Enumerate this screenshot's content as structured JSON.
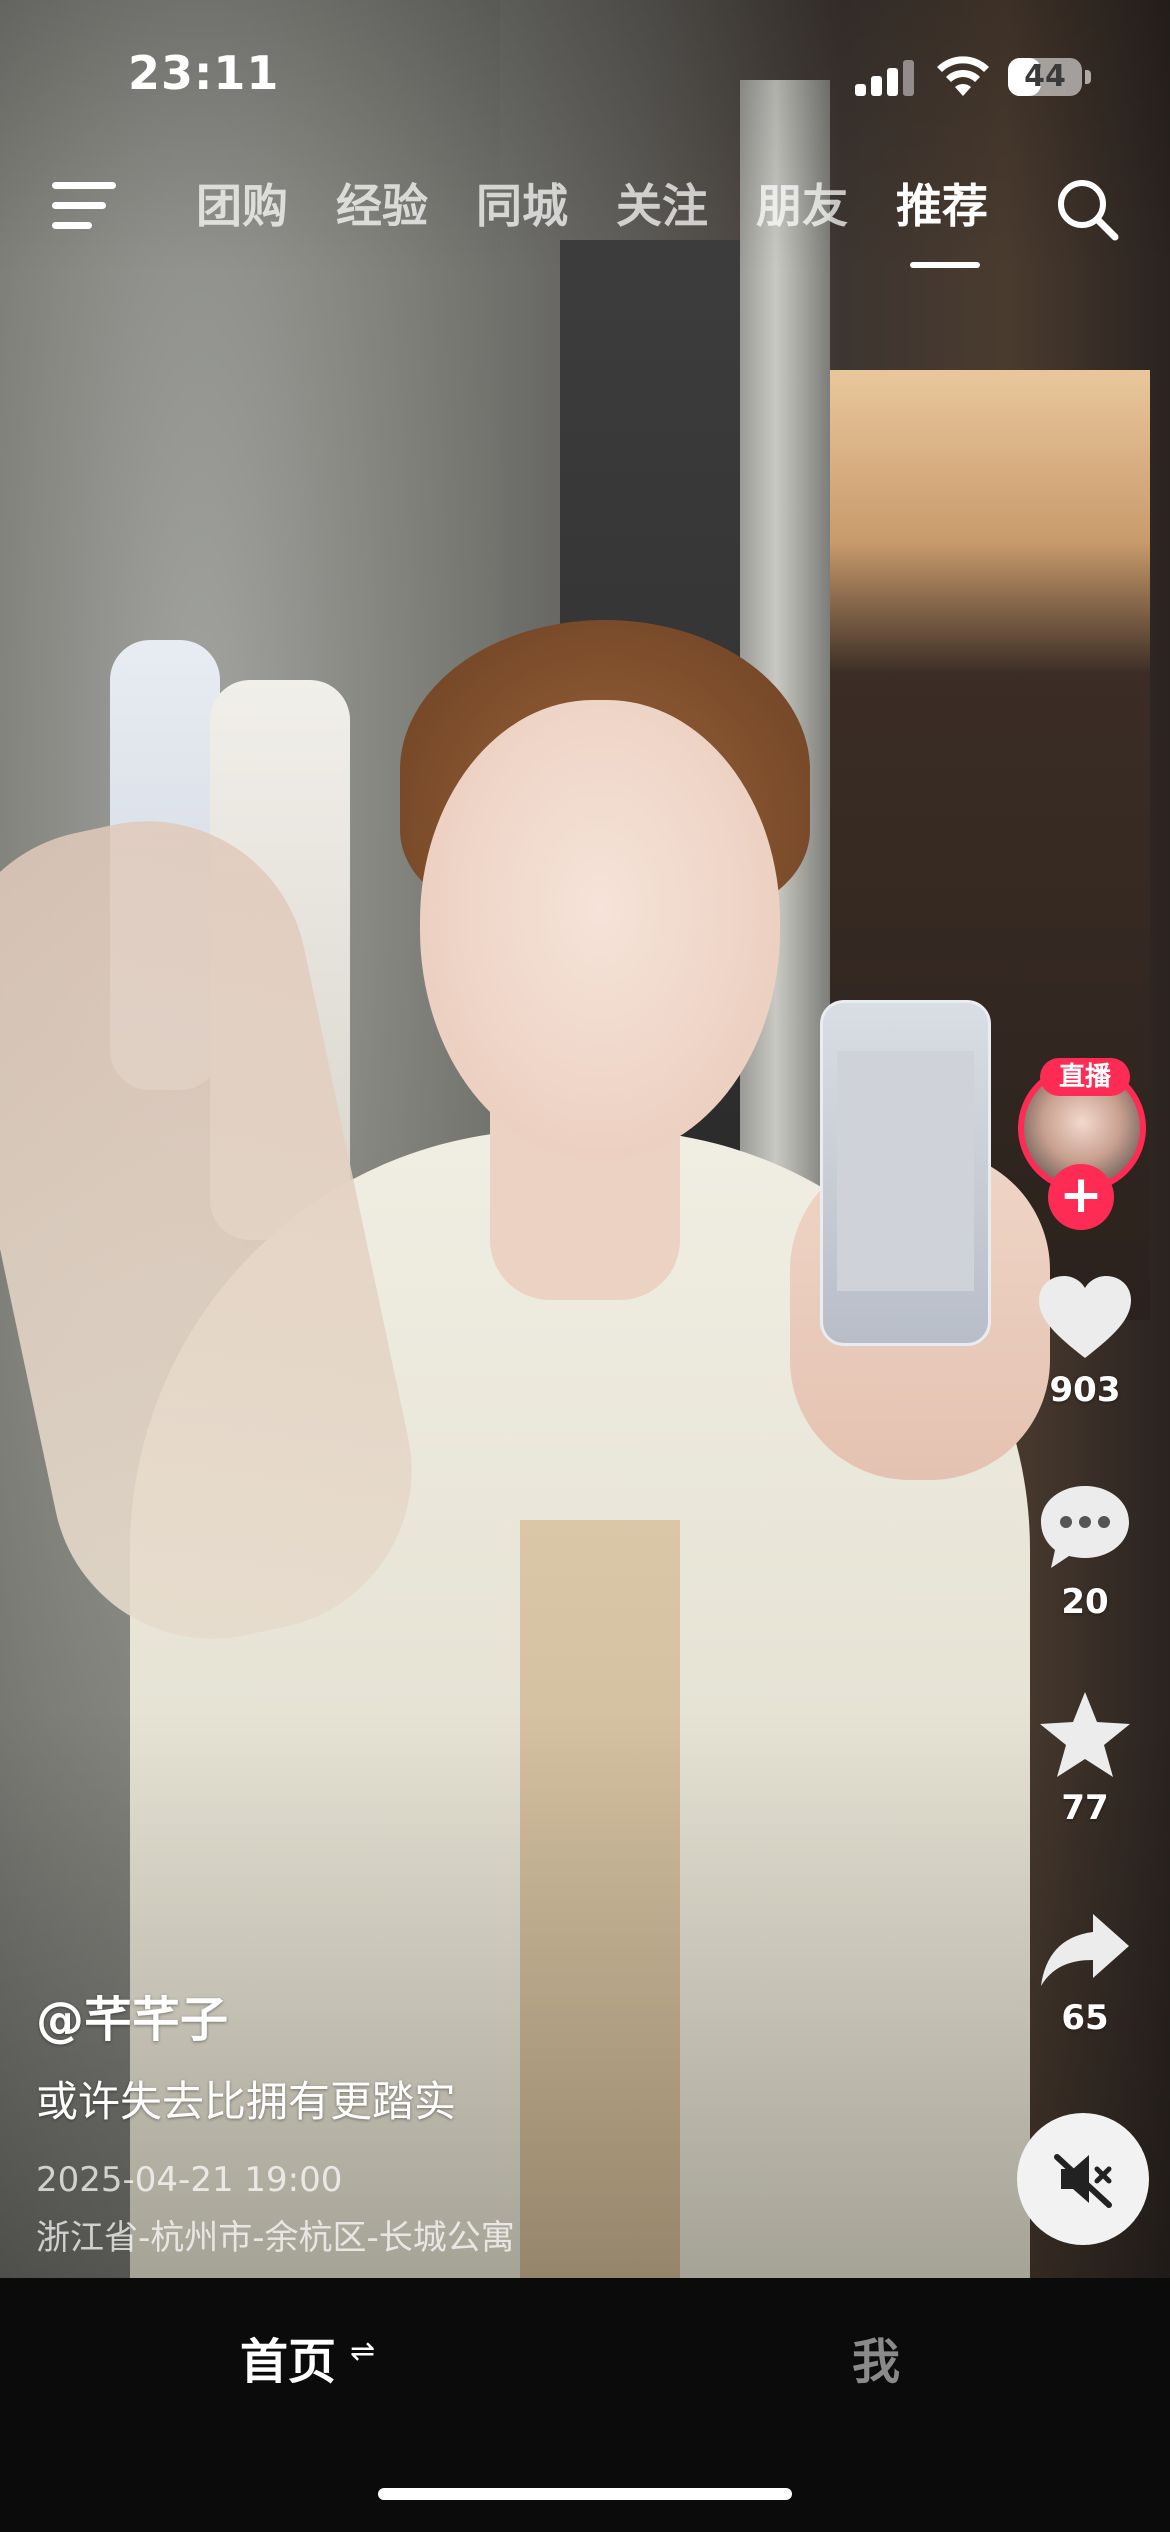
{
  "status_bar": {
    "time": "23:11",
    "battery_level": "44"
  },
  "top_nav": {
    "tabs": [
      {
        "label": "团购"
      },
      {
        "label": "经验"
      },
      {
        "label": "同城"
      },
      {
        "label": "关注"
      },
      {
        "label": "朋友"
      },
      {
        "label": "推荐"
      }
    ],
    "active_tab": "推荐"
  },
  "right_rail": {
    "live_badge": "直播",
    "like_count": "903",
    "comment_count": "20",
    "favorite_count": "77",
    "share_count": "65"
  },
  "caption": {
    "author": "@芊芊子",
    "text": "或许失去比拥有更踏实",
    "date": "2025-04-21 19:00",
    "location": "浙江省-杭州市-余杭区-长城公寓"
  },
  "bottom_nav": {
    "home_label": "首页",
    "home_swap_glyph": "⇌",
    "me_label": "我"
  },
  "colors": {
    "accent": "#fe2c55",
    "bottom_bar": "#0b0b0b"
  }
}
